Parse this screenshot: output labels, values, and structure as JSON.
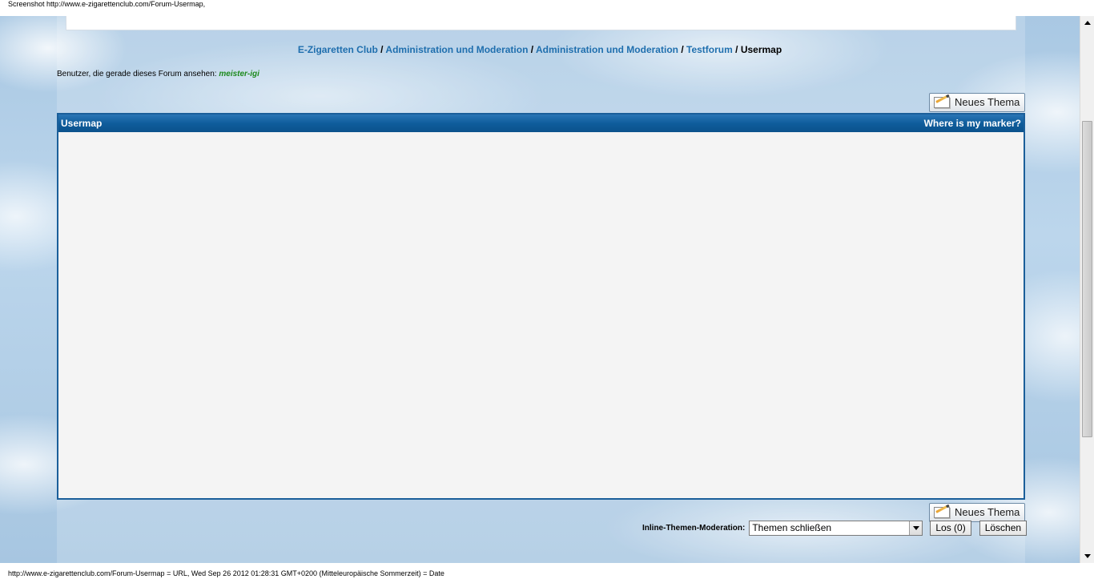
{
  "capture": {
    "top_caption": "Screenshot http://www.e-zigarettenclub.com/Forum-Usermap,",
    "bottom_caption": "http://www.e-zigarettenclub.com/Forum-Usermap = URL, Wed Sep 26 2012 01:28:31 GMT+0200 (Mitteleuropäische Sommerzeit) = Date"
  },
  "breadcrumb": {
    "items": [
      "E-Zigaretten Club",
      "Administration und Moderation",
      "Administration und Moderation",
      "Testforum"
    ],
    "separator": "/",
    "current": "Usermap"
  },
  "viewers": {
    "label": "Benutzer, die gerade dieses Forum ansehen:",
    "user": "meister-igi"
  },
  "new_topic_button": {
    "label": "Neues Thema",
    "icon": "notepad-pencil-icon"
  },
  "panel": {
    "title": "Usermap",
    "right_link": "Where is my marker?"
  },
  "moderation": {
    "label": "Inline-Themen-Moderation:",
    "selected_option": "Themen schließen",
    "go_button": "Los (0)",
    "delete_button": "Löschen"
  },
  "colors": {
    "link": "#1f6fae",
    "panel_header": "#0f5d9c",
    "user_online": "#1d8a1d"
  }
}
